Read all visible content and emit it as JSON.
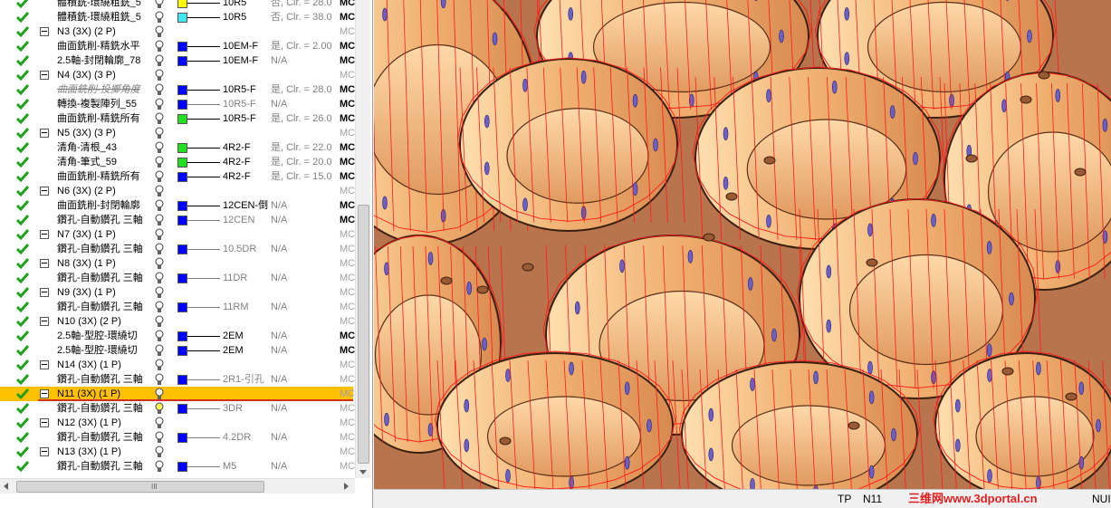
{
  "tree": {
    "rows": [
      {
        "kind": "op",
        "name": "體積銑-環繞粗銑_5",
        "color": "#ffff00",
        "tool": "10R5",
        "clr": "否, Clr. = 28.0",
        "mc": "MC",
        "mc_gray": false
      },
      {
        "kind": "op",
        "name": "體積銑-環繞粗銑_5",
        "color": "#40e8f0",
        "tool": "10R5",
        "clr": "否, Clr. = 38.0",
        "mc": "MC",
        "mc_gray": false
      },
      {
        "kind": "group",
        "name": "N3 (3X) (2 P)",
        "mc": "MC"
      },
      {
        "kind": "op",
        "name": "曲面銑削-精銑水平",
        "color": "#0000ff",
        "tool": "10EM-F",
        "clr": "是, Clr. = 2.00",
        "mc": "MC",
        "mc_gray": false
      },
      {
        "kind": "op",
        "name": "2.5軸-封閉輪廓_78",
        "color": "#0000ff",
        "tool": "10EM-F",
        "clr": "N/A",
        "mc": "MC",
        "mc_gray": false
      },
      {
        "kind": "group",
        "name": "N4 (3X) (3 P)",
        "mc": "MC"
      },
      {
        "kind": "op",
        "name": "曲面銑削-投擲角度",
        "italic": true,
        "color": "#0000ff",
        "tool": "10R5-F",
        "clr": "是, Clr. = 28.0",
        "mc": "MC",
        "mc_gray": false
      },
      {
        "kind": "op",
        "name": "轉換-複製陣列_55",
        "color": "#0000ff",
        "tool": "10R5-F",
        "tool_gray": true,
        "clr": "N/A",
        "mc": "MC",
        "mc_gray": false
      },
      {
        "kind": "op",
        "name": "曲面銑削-精銑所有",
        "color": "#20e020",
        "tool": "10R5-F",
        "clr": "是, Clr. = 26.0",
        "mc": "MC",
        "mc_gray": false
      },
      {
        "kind": "group",
        "name": "N5 (3X) (3 P)",
        "mc": "MC"
      },
      {
        "kind": "op",
        "name": "清角-清根_43",
        "color": "#20e020",
        "tool": "4R2-F",
        "clr": "是, Clr. = 22.0",
        "mc": "MC",
        "mc_gray": false
      },
      {
        "kind": "op",
        "name": "清角-筆式_59",
        "color": "#20e020",
        "tool": "4R2-F",
        "clr": "是, Clr. = 20.0",
        "mc": "MC",
        "mc_gray": false
      },
      {
        "kind": "op",
        "name": "曲面銑削-精銑所有",
        "color": "#0000ff",
        "tool": "4R2-F",
        "clr": "是, Clr. = 15.0",
        "mc": "MC",
        "mc_gray": false
      },
      {
        "kind": "group",
        "name": "N6 (3X) (2 P)",
        "mc": "MC"
      },
      {
        "kind": "op",
        "name": "曲面銑削-封閉輪廓",
        "color": "#0000ff",
        "tool": "12CEN-倒",
        "clr": "N/A",
        "mc": "MC",
        "mc_gray": false
      },
      {
        "kind": "op",
        "name": "鑽孔-自動鑽孔 三軸",
        "color": "#0000ff",
        "tool": "12CEN",
        "tool_gray": true,
        "clr": "N/A",
        "mc": "MC",
        "mc_gray": false
      },
      {
        "kind": "group",
        "name": "N7 (3X) (1 P)",
        "mc": "MC"
      },
      {
        "kind": "op",
        "name": "鑽孔-自動鑽孔 三軸",
        "color": "#0000ff",
        "tool": "10.5DR",
        "tool_gray": true,
        "clr": "N/A",
        "mc": "MC",
        "mc_gray": true
      },
      {
        "kind": "group",
        "name": "N8 (3X) (1 P)",
        "mc": "MC"
      },
      {
        "kind": "op",
        "name": "鑽孔-自動鑽孔 三軸",
        "color": "#0000ff",
        "tool": "11DR",
        "tool_gray": true,
        "clr": "N/A",
        "mc": "MC",
        "mc_gray": true
      },
      {
        "kind": "group",
        "name": "N9 (3X) (1 P)",
        "mc": "MC"
      },
      {
        "kind": "op",
        "name": "鑽孔-自動鑽孔 三軸",
        "color": "#0000ff",
        "tool": "11RM",
        "tool_gray": true,
        "clr": "N/A",
        "mc": "MC",
        "mc_gray": true
      },
      {
        "kind": "group",
        "name": "N10 (3X) (2 P)",
        "mc": "MC"
      },
      {
        "kind": "op",
        "name": "2.5軸-型腔-環繞切",
        "color": "#0000ff",
        "tool": "2EM",
        "clr": "N/A",
        "mc": "MC",
        "mc_gray": false
      },
      {
        "kind": "op",
        "name": "2.5軸-型腔-環繞切",
        "color": "#0000ff",
        "tool": "2EM",
        "clr": "N/A",
        "mc": "MC",
        "mc_gray": false
      },
      {
        "kind": "group",
        "name": "N14 (3X) (1 P)",
        "mc": "MC"
      },
      {
        "kind": "op",
        "name": "鑽孔-自動鑽孔 三軸",
        "color": "#0000ff",
        "tool": "2R1-引孔",
        "tool_gray": true,
        "clr": "N/A",
        "mc": "MC",
        "mc_gray": true
      },
      {
        "kind": "group",
        "name": "N11 (3X) (1 P)",
        "mc": "MC",
        "highlight": true
      },
      {
        "kind": "op",
        "name": "鑽孔-自動鑽孔 三軸",
        "color": "#0000ff",
        "tool": "3DR",
        "tool_gray": true,
        "clr": "N/A",
        "mc": "MC",
        "mc_gray": true,
        "bulb_on": true
      },
      {
        "kind": "group",
        "name": "N12 (3X) (1 P)",
        "mc": "MC"
      },
      {
        "kind": "op",
        "name": "鑽孔-自動鑽孔 三軸",
        "color": "#0000ff",
        "tool": "4.2DR",
        "tool_gray": true,
        "clr": "N/A",
        "mc": "MC",
        "mc_gray": true
      },
      {
        "kind": "group",
        "name": "N13 (3X) (1 P)",
        "mc": "MC"
      },
      {
        "kind": "op",
        "name": "鑽孔-自動鑽孔 三軸",
        "color": "#0000ff",
        "tool": "M5",
        "tool_gray": true,
        "clr": "N/A",
        "mc": "MC",
        "mc_gray": true
      }
    ]
  },
  "scrollbar": {
    "grip": "III"
  },
  "status": {
    "tp": "TP",
    "operation": "N11",
    "watermark": "三维网www.3dportal.cn",
    "num": "NUI"
  },
  "colors": {
    "highlight": "#ffc000",
    "check": "#1ea01e",
    "toolpath": "#ff1a1a",
    "part_surface": "#f0b070"
  }
}
